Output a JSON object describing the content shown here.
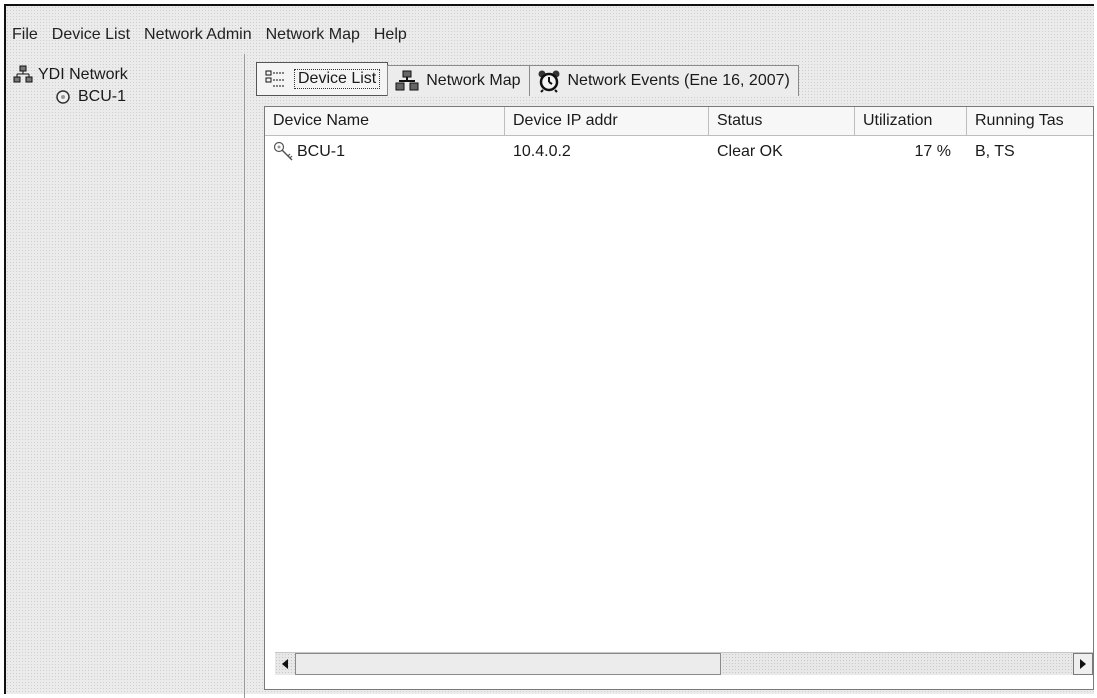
{
  "menubar": {
    "items": [
      "File",
      "Device List",
      "Network Admin",
      "Network Map",
      "Help"
    ]
  },
  "sidebar": {
    "root_label": "YDI Network",
    "children": [
      "BCU-1"
    ]
  },
  "tabs": [
    {
      "label": "Device List",
      "icon": "device-list-icon",
      "active": true
    },
    {
      "label": "Network Map",
      "icon": "network-map-icon",
      "active": false
    },
    {
      "label": "Network Events (Ene 16, 2007)",
      "icon": "alarm-clock-icon",
      "active": false
    }
  ],
  "table": {
    "columns": [
      "Device Name",
      "Device IP addr",
      "Status",
      "Utilization",
      "Running Tas"
    ],
    "rows": [
      {
        "device_name": "BCU-1",
        "ip": "10.4.0.2",
        "status": "Clear OK",
        "utilization": "17 %",
        "tasks": "B, TS"
      }
    ]
  },
  "colors": {
    "window_bg": "#ebebeb",
    "list_bg": "#ffffff",
    "border": "#7a7a7a"
  }
}
